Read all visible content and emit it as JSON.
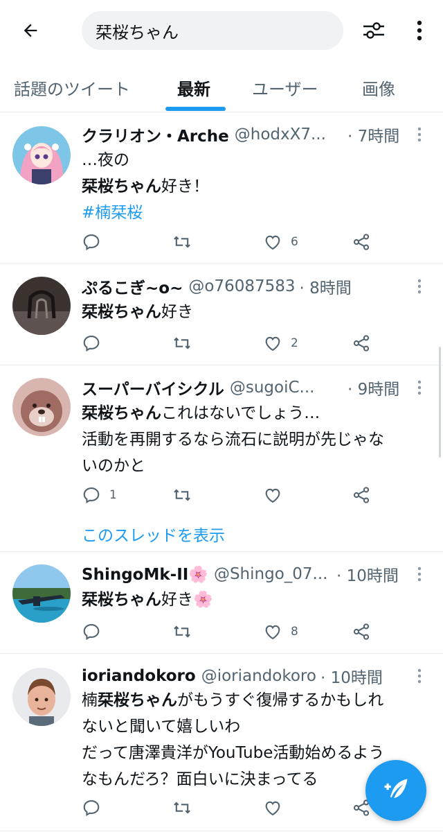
{
  "search": {
    "query": "栞桜ちゃん"
  },
  "tabs": [
    {
      "label": "話題のツイート"
    },
    {
      "label": "最新"
    },
    {
      "label": "ユーザー"
    },
    {
      "label": "画像"
    }
  ],
  "tweets": [
    {
      "name": "クラリオン・Arche",
      "handle": "@hodxX7...",
      "time": "· 7時間",
      "line1": "…夜の",
      "line2_bold": "栞桜ちゃん",
      "line2_rest": "好き！",
      "hashtag": "#楠栞桜",
      "likes": "6"
    },
    {
      "name": "ぷるこぎ~o~",
      "handle": "@o76087583",
      "time": "· 8時間",
      "text_bold": "栞桜ちゃん",
      "text_rest": "好き",
      "likes": "2"
    },
    {
      "name": "スーパーバイシクル",
      "handle": "@sugoiC...",
      "time": "· 9時間",
      "text_bold": "栞桜ちゃん",
      "text_rest1": "これはないでしょう…",
      "line2": "活動を再開するなら流石に説明が先じゃな",
      "line3": "いのかと",
      "replies": "1",
      "thread_link": "このスレッドを表示"
    },
    {
      "name": "ShingoMk-II🌸",
      "handle": "@Shingo_07...",
      "time": "· 10時間",
      "text_bold": "栞桜ちゃん",
      "text_rest": "好き🌸",
      "likes": "8"
    },
    {
      "name": "ioriandokoro",
      "handle": "@ioriandokoro",
      "time": "· 10時間",
      "pre": "楠",
      "text_bold": "栞桜ちゃん",
      "text_rest": "がもうすぐ復帰するかもしれ",
      "line2": "ないと聞いて嬉しいわ",
      "line3": "だって唐澤貴洋がYouTube活動始めるよう",
      "line4": "なもんだろ？面白いに決まってる"
    }
  ],
  "colors": {
    "accent": "#1d9bf0",
    "text": "#0f1419",
    "secondary": "#536471",
    "divider": "#e6ecf0"
  },
  "icons": [
    "back-arrow-icon",
    "filter-icon",
    "more-vertical-icon",
    "reply-icon",
    "retweet-icon",
    "like-icon",
    "share-icon",
    "compose-tweet-icon"
  ]
}
